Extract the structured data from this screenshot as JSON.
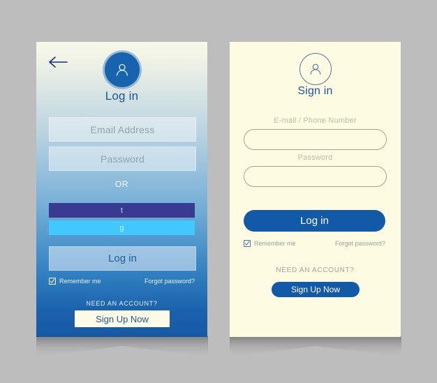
{
  "page": {
    "background_color": "#bdbdbd",
    "accent_blue": "#125aa8",
    "cream": "#fdfbe2"
  },
  "left_card": {
    "back_icon": "back-arrow-icon",
    "avatar_icon": "user-avatar-icon",
    "title": "Log in",
    "email_placeholder": "Email Address",
    "password_placeholder": "Password",
    "divider_label": "OR",
    "social": [
      {
        "key": "twitter",
        "label": "t",
        "color": "#383b8f"
      },
      {
        "key": "google",
        "label": "g",
        "color": "#41c8ff"
      }
    ],
    "login_label": "Log in",
    "remember_label": "Remember me",
    "remember_checked": true,
    "forgot_label": "Forgot password?",
    "need_account_label": "NEED AN ACCOUNT?",
    "signup_label": "Sign Up Now"
  },
  "right_card": {
    "avatar_icon": "user-avatar-icon",
    "title": "Sign in",
    "email_label": "E-mail / Phone Number",
    "email_value": "",
    "password_label": "Password",
    "password_value": "",
    "login_label": "Log in",
    "remember_label": "Remember me",
    "remember_checked": true,
    "forgot_label": "Forgot password?",
    "need_account_label": "NEED AN ACCOUNT?",
    "signup_label": "Sign Up Now"
  }
}
